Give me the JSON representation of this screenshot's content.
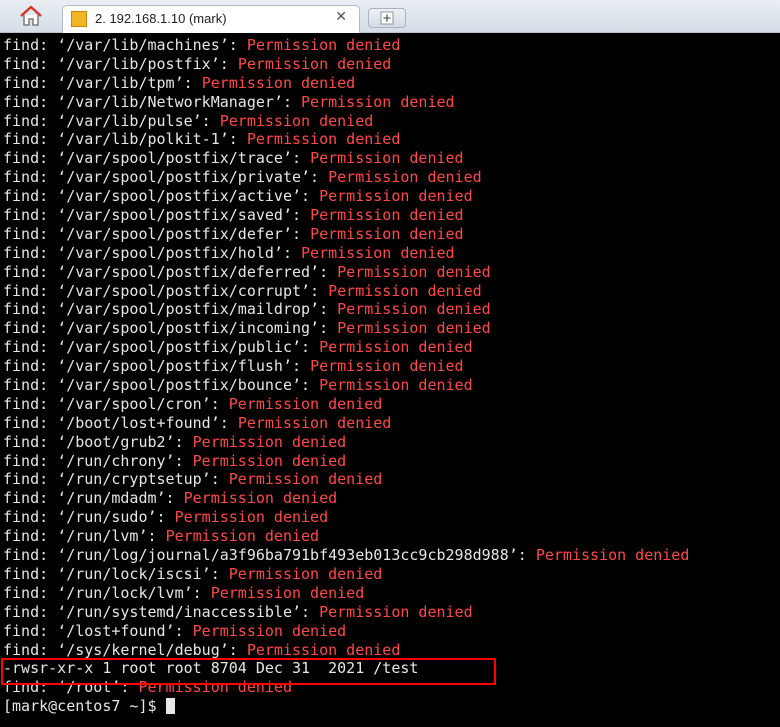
{
  "tabbar": {
    "tab_title": "2. 192.168.1.10 (mark)",
    "close_glyph": "✕",
    "newtab_glyph": "+"
  },
  "terminal": {
    "error_suffix": "Permission denied",
    "lines": [
      {
        "prefix": "find: ",
        "path": "‘/var/lib/machines’: ",
        "error": "Permission denied"
      },
      {
        "prefix": "find: ",
        "path": "‘/var/lib/postfix’: ",
        "error": "Permission denied"
      },
      {
        "prefix": "find: ",
        "path": "‘/var/lib/tpm’: ",
        "error": "Permission denied"
      },
      {
        "prefix": "find: ",
        "path": "‘/var/lib/NetworkManager’: ",
        "error": "Permission denied"
      },
      {
        "prefix": "find: ",
        "path": "‘/var/lib/pulse’: ",
        "error": "Permission denied"
      },
      {
        "prefix": "find: ",
        "path": "‘/var/lib/polkit-1’: ",
        "error": "Permission denied"
      },
      {
        "prefix": "find: ",
        "path": "‘/var/spool/postfix/trace’: ",
        "error": "Permission denied"
      },
      {
        "prefix": "find: ",
        "path": "‘/var/spool/postfix/private’: ",
        "error": "Permission denied"
      },
      {
        "prefix": "find: ",
        "path": "‘/var/spool/postfix/active’: ",
        "error": "Permission denied"
      },
      {
        "prefix": "find: ",
        "path": "‘/var/spool/postfix/saved’: ",
        "error": "Permission denied"
      },
      {
        "prefix": "find: ",
        "path": "‘/var/spool/postfix/defer’: ",
        "error": "Permission denied"
      },
      {
        "prefix": "find: ",
        "path": "‘/var/spool/postfix/hold’: ",
        "error": "Permission denied"
      },
      {
        "prefix": "find: ",
        "path": "‘/var/spool/postfix/deferred’: ",
        "error": "Permission denied"
      },
      {
        "prefix": "find: ",
        "path": "‘/var/spool/postfix/corrupt’: ",
        "error": "Permission denied"
      },
      {
        "prefix": "find: ",
        "path": "‘/var/spool/postfix/maildrop’: ",
        "error": "Permission denied"
      },
      {
        "prefix": "find: ",
        "path": "‘/var/spool/postfix/incoming’: ",
        "error": "Permission denied"
      },
      {
        "prefix": "find: ",
        "path": "‘/var/spool/postfix/public’: ",
        "error": "Permission denied"
      },
      {
        "prefix": "find: ",
        "path": "‘/var/spool/postfix/flush’: ",
        "error": "Permission denied"
      },
      {
        "prefix": "find: ",
        "path": "‘/var/spool/postfix/bounce’: ",
        "error": "Permission denied"
      },
      {
        "prefix": "find: ",
        "path": "‘/var/spool/cron’: ",
        "error": "Permission denied"
      },
      {
        "prefix": "find: ",
        "path": "‘/boot/lost+found’: ",
        "error": "Permission denied"
      },
      {
        "prefix": "find: ",
        "path": "‘/boot/grub2’: ",
        "error": "Permission denied"
      },
      {
        "prefix": "find: ",
        "path": "‘/run/chrony’: ",
        "error": "Permission denied"
      },
      {
        "prefix": "find: ",
        "path": "‘/run/cryptsetup’: ",
        "error": "Permission denied"
      },
      {
        "prefix": "find: ",
        "path": "‘/run/mdadm’: ",
        "error": "Permission denied"
      },
      {
        "prefix": "find: ",
        "path": "‘/run/sudo’: ",
        "error": "Permission denied"
      },
      {
        "prefix": "find: ",
        "path": "‘/run/lvm’: ",
        "error": "Permission denied"
      },
      {
        "prefix": "find: ",
        "path": "‘/run/log/journal/a3f96ba791bf493eb013cc9cb298d988’: ",
        "error": "Permission denied"
      },
      {
        "prefix": "find: ",
        "path": "‘/run/lock/iscsi’: ",
        "error": "Permission denied"
      },
      {
        "prefix": "find: ",
        "path": "‘/run/lock/lvm’: ",
        "error": "Permission denied"
      },
      {
        "prefix": "find: ",
        "path": "‘/run/systemd/inaccessible’: ",
        "error": "Permission denied"
      },
      {
        "prefix": "find: ",
        "path": "‘/lost+found’: ",
        "error": "Permission denied"
      },
      {
        "prefix": "find: ",
        "path": "‘/sys/kernel/debug’: ",
        "error": "Permission denied"
      }
    ],
    "highlighted_line": "-rwsr-xr-x 1 root root 8704 Dec 31  2021 /test",
    "after_line": {
      "prefix": "find: ",
      "path": "‘/root’: ",
      "error": "Permission denied"
    },
    "prompt": "[mark@centos7 ~]$ "
  },
  "colors": {
    "error": "#ff4a4a",
    "highlight_border": "#ff0000",
    "terminal_bg": "#000000",
    "terminal_fg": "#e6e6e6"
  },
  "icons": {
    "home": "home-icon",
    "tab": "terminal-icon",
    "close": "close-icon",
    "newtab": "add-icon"
  }
}
